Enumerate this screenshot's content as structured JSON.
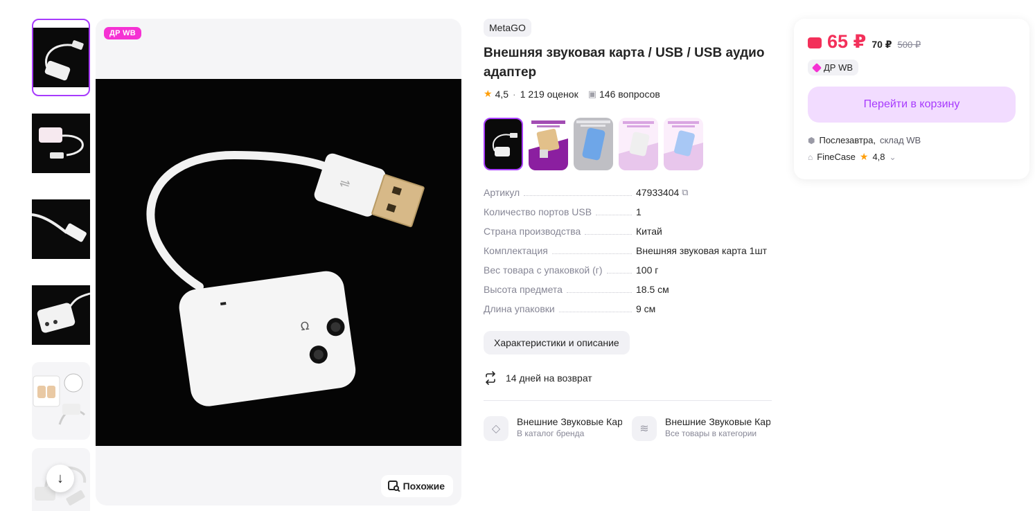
{
  "gallery": {
    "thumbnails": [
      "thumb-1",
      "thumb-2",
      "thumb-3",
      "thumb-4",
      "thumb-5",
      "thumb-6"
    ],
    "badge": "ДР WB",
    "similar_label": "Похожие",
    "scroll_icon": "arrow-down-icon"
  },
  "product": {
    "brand": "MetaGO",
    "title": "Внешняя звуковая карта / USB / USB аудио адаптер",
    "rating": "4,5",
    "reviews": "1 219 оценок",
    "questions": "146 вопросов",
    "color_variants": 5,
    "specs": [
      {
        "key": "Артикул",
        "value": "47933404"
      },
      {
        "key": "Количество портов USB",
        "value": "1"
      },
      {
        "key": "Страна производства",
        "value": "Китай"
      },
      {
        "key": "Комплектация",
        "value": "Внешняя звуковая карта 1шт"
      },
      {
        "key": "Вес товара с упаковкой (г)",
        "value": "100 г"
      },
      {
        "key": "Высота предмета",
        "value": "18.5 см"
      },
      {
        "key": "Длина упаковки",
        "value": "9 см"
      }
    ],
    "characteristics_button": "Характеристики и описание",
    "return_policy": "14 дней на возврат",
    "links": [
      {
        "title": "Внешние Звуковые Кар",
        "subtitle": "В каталог бренда",
        "icon": "tag-icon"
      },
      {
        "title": "Внешние Звуковые Кар",
        "subtitle": "Все товары в категории",
        "icon": "layers-icon"
      }
    ]
  },
  "price_card": {
    "price_now": "65 ₽",
    "price_wallet": "70 ₽",
    "price_old": "500 ₽",
    "promo_chip": "ДР WB",
    "cart_button": "Перейти в корзину",
    "delivery_when": "Послезавтра,",
    "delivery_where": "склад WB",
    "seller_name": "FineCase",
    "seller_rating": "4,8"
  },
  "colors": {
    "accent": "#a73afd",
    "price": "#f3305a",
    "badge": "#f531d3",
    "cart_bg": "#f2dcff"
  }
}
